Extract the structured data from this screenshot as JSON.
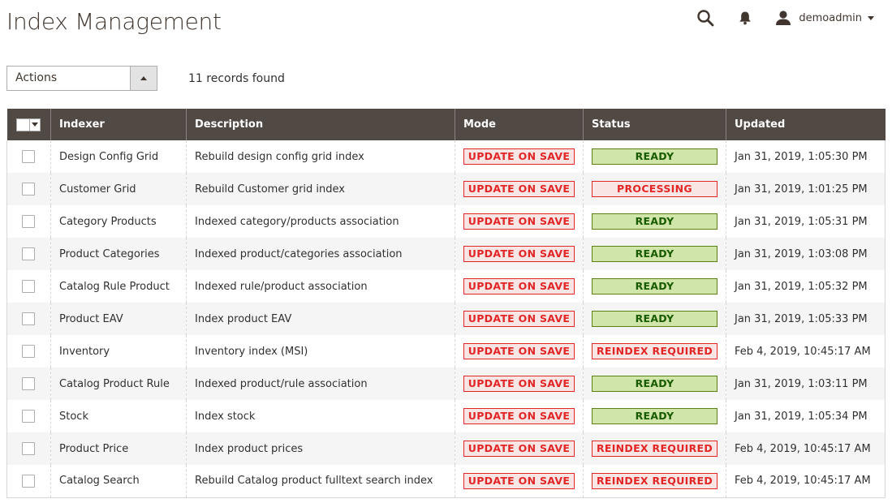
{
  "page": {
    "title": "Index Management"
  },
  "header": {
    "username": "demoadmin"
  },
  "toolbar": {
    "actions_label": "Actions",
    "records_text": "11 records found"
  },
  "grid": {
    "columns": [
      "Indexer",
      "Description",
      "Mode",
      "Status",
      "Updated"
    ],
    "rows": [
      {
        "indexer": "Design Config Grid",
        "description": "Rebuild design config grid index",
        "mode": "UPDATE ON SAVE",
        "status": "READY",
        "updated": "Jan 31, 2019, 1:05:30 PM"
      },
      {
        "indexer": "Customer Grid",
        "description": "Rebuild Customer grid index",
        "mode": "UPDATE ON SAVE",
        "status": "PROCESSING",
        "updated": "Jan 31, 2019, 1:01:25 PM"
      },
      {
        "indexer": "Category Products",
        "description": "Indexed category/products association",
        "mode": "UPDATE ON SAVE",
        "status": "READY",
        "updated": "Jan 31, 2019, 1:05:31 PM"
      },
      {
        "indexer": "Product Categories",
        "description": "Indexed product/categories association",
        "mode": "UPDATE ON SAVE",
        "status": "READY",
        "updated": "Jan 31, 2019, 1:03:08 PM"
      },
      {
        "indexer": "Catalog Rule Product",
        "description": "Indexed rule/product association",
        "mode": "UPDATE ON SAVE",
        "status": "READY",
        "updated": "Jan 31, 2019, 1:05:32 PM"
      },
      {
        "indexer": "Product EAV",
        "description": "Index product EAV",
        "mode": "UPDATE ON SAVE",
        "status": "READY",
        "updated": "Jan 31, 2019, 1:05:33 PM"
      },
      {
        "indexer": "Inventory",
        "description": "Inventory index (MSI)",
        "mode": "UPDATE ON SAVE",
        "status": "REINDEX REQUIRED",
        "updated": "Feb 4, 2019, 10:45:17 AM"
      },
      {
        "indexer": "Catalog Product Rule",
        "description": "Indexed product/rule association",
        "mode": "UPDATE ON SAVE",
        "status": "READY",
        "updated": "Jan 31, 2019, 1:03:11 PM"
      },
      {
        "indexer": "Stock",
        "description": "Index stock",
        "mode": "UPDATE ON SAVE",
        "status": "READY",
        "updated": "Jan 31, 2019, 1:05:34 PM"
      },
      {
        "indexer": "Product Price",
        "description": "Index product prices",
        "mode": "UPDATE ON SAVE",
        "status": "REINDEX REQUIRED",
        "updated": "Feb 4, 2019, 10:45:17 AM"
      },
      {
        "indexer": "Catalog Search",
        "description": "Rebuild Catalog product fulltext search index",
        "mode": "UPDATE ON SAVE",
        "status": "REINDEX REQUIRED",
        "updated": "Feb 4, 2019, 10:45:17 AM"
      }
    ]
  },
  "icons": {
    "search": "search-icon",
    "notifications": "bell-icon",
    "user": "user-icon"
  },
  "colors": {
    "header_bg": "#514943",
    "badge_red": "#e22626",
    "badge_green_text": "#185b00",
    "badge_green_bg": "#d0e5a9"
  }
}
